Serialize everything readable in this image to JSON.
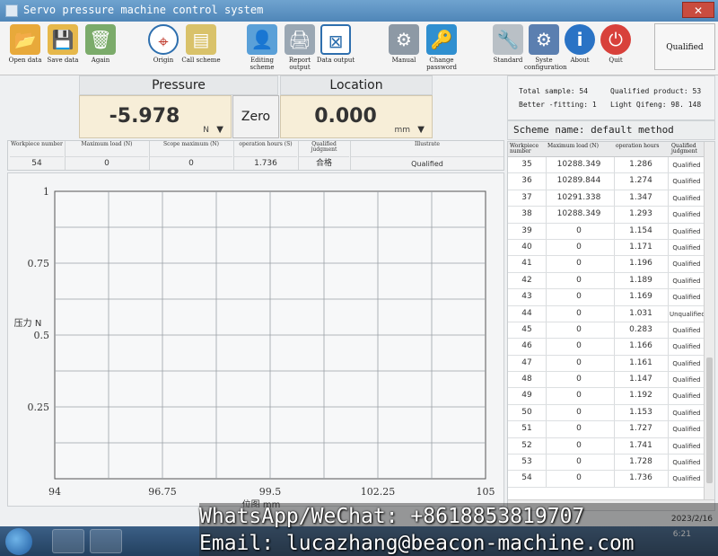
{
  "window": {
    "title": "Servo pressure machine control system"
  },
  "toolbar": {
    "open_data": "Open data",
    "save_data": "Save data",
    "again": "Again",
    "origin": "Origin",
    "call_scheme": "Call scheme",
    "editing_scheme": "Editing scheme",
    "report_output": "Report output",
    "data_output": "Data output",
    "manual": "Manual",
    "change_password": "Change password",
    "standard": "Standard",
    "system_configuration": "Syste configuration",
    "about": "About",
    "quit": "Quit",
    "qualified": "Qualified"
  },
  "pressure": {
    "label": "Pressure",
    "value": "-5.978",
    "unit": "N"
  },
  "location": {
    "label": "Location",
    "value": "0.000",
    "unit": "mm"
  },
  "zero_button": "Zero",
  "summary": {
    "total_sample": "Total sample: 54",
    "qualified_product": "Qualified product: 53",
    "better_fitting": "Better -fitting: 1",
    "light_qifeng": "Light Qifeng: 98. 148"
  },
  "scheme": "Scheme name: default method",
  "measurement": {
    "headers": [
      "Workpiece number",
      "Maximum load (N)",
      "Scope maximum (N)",
      "operation hours (S)",
      "Qualified judgment",
      "Illustrate"
    ],
    "values": [
      "54",
      "0",
      "0",
      "1.736",
      "合格",
      "Qualified"
    ]
  },
  "chart_data": {
    "type": "line",
    "series": [],
    "xlabel": "位图 mm",
    "ylabel": "压力 N",
    "xlim": [
      94,
      105
    ],
    "ylim": [
      0,
      1
    ],
    "xticks": [
      "94",
      "96.75",
      "99.5",
      "102.25",
      "105"
    ],
    "yticks": [
      "0.25",
      "0.5",
      "0.75",
      "1"
    ],
    "grid": true
  },
  "history": {
    "headers": [
      "Workpiece number",
      "Maximum load (N)",
      "operation hours",
      "Qualified judgment"
    ],
    "rows": [
      [
        "35",
        "10288.349",
        "1.286",
        "Qualified"
      ],
      [
        "36",
        "10289.844",
        "1.274",
        "Qualified"
      ],
      [
        "37",
        "10291.338",
        "1.347",
        "Qualified"
      ],
      [
        "38",
        "10288.349",
        "1.293",
        "Qualified"
      ],
      [
        "39",
        "0",
        "1.154",
        "Qualified"
      ],
      [
        "40",
        "0",
        "1.171",
        "Qualified"
      ],
      [
        "41",
        "0",
        "1.196",
        "Qualified"
      ],
      [
        "42",
        "0",
        "1.189",
        "Qualified"
      ],
      [
        "43",
        "0",
        "1.169",
        "Qualified"
      ],
      [
        "44",
        "0",
        "1.031",
        "Unqualified"
      ],
      [
        "45",
        "0",
        "0.283",
        "Qualified"
      ],
      [
        "46",
        "0",
        "1.166",
        "Qualified"
      ],
      [
        "47",
        "0",
        "1.161",
        "Qualified"
      ],
      [
        "48",
        "0",
        "1.147",
        "Qualified"
      ],
      [
        "49",
        "0",
        "1.192",
        "Qualified"
      ],
      [
        "50",
        "0",
        "1.153",
        "Qualified"
      ],
      [
        "51",
        "0",
        "1.727",
        "Qualified"
      ],
      [
        "52",
        "0",
        "1.741",
        "Qualified"
      ],
      [
        "53",
        "0",
        "1.728",
        "Qualified"
      ],
      [
        "54",
        "0",
        "1.736",
        "Qualified"
      ]
    ]
  },
  "status": {
    "date": "2023/2/16",
    "time": "6:21"
  },
  "overlay": {
    "contact_line": "WhatsApp/WeChat: +8618853819707",
    "email_line": "Email: lucazhang@beacon-machine.com"
  }
}
